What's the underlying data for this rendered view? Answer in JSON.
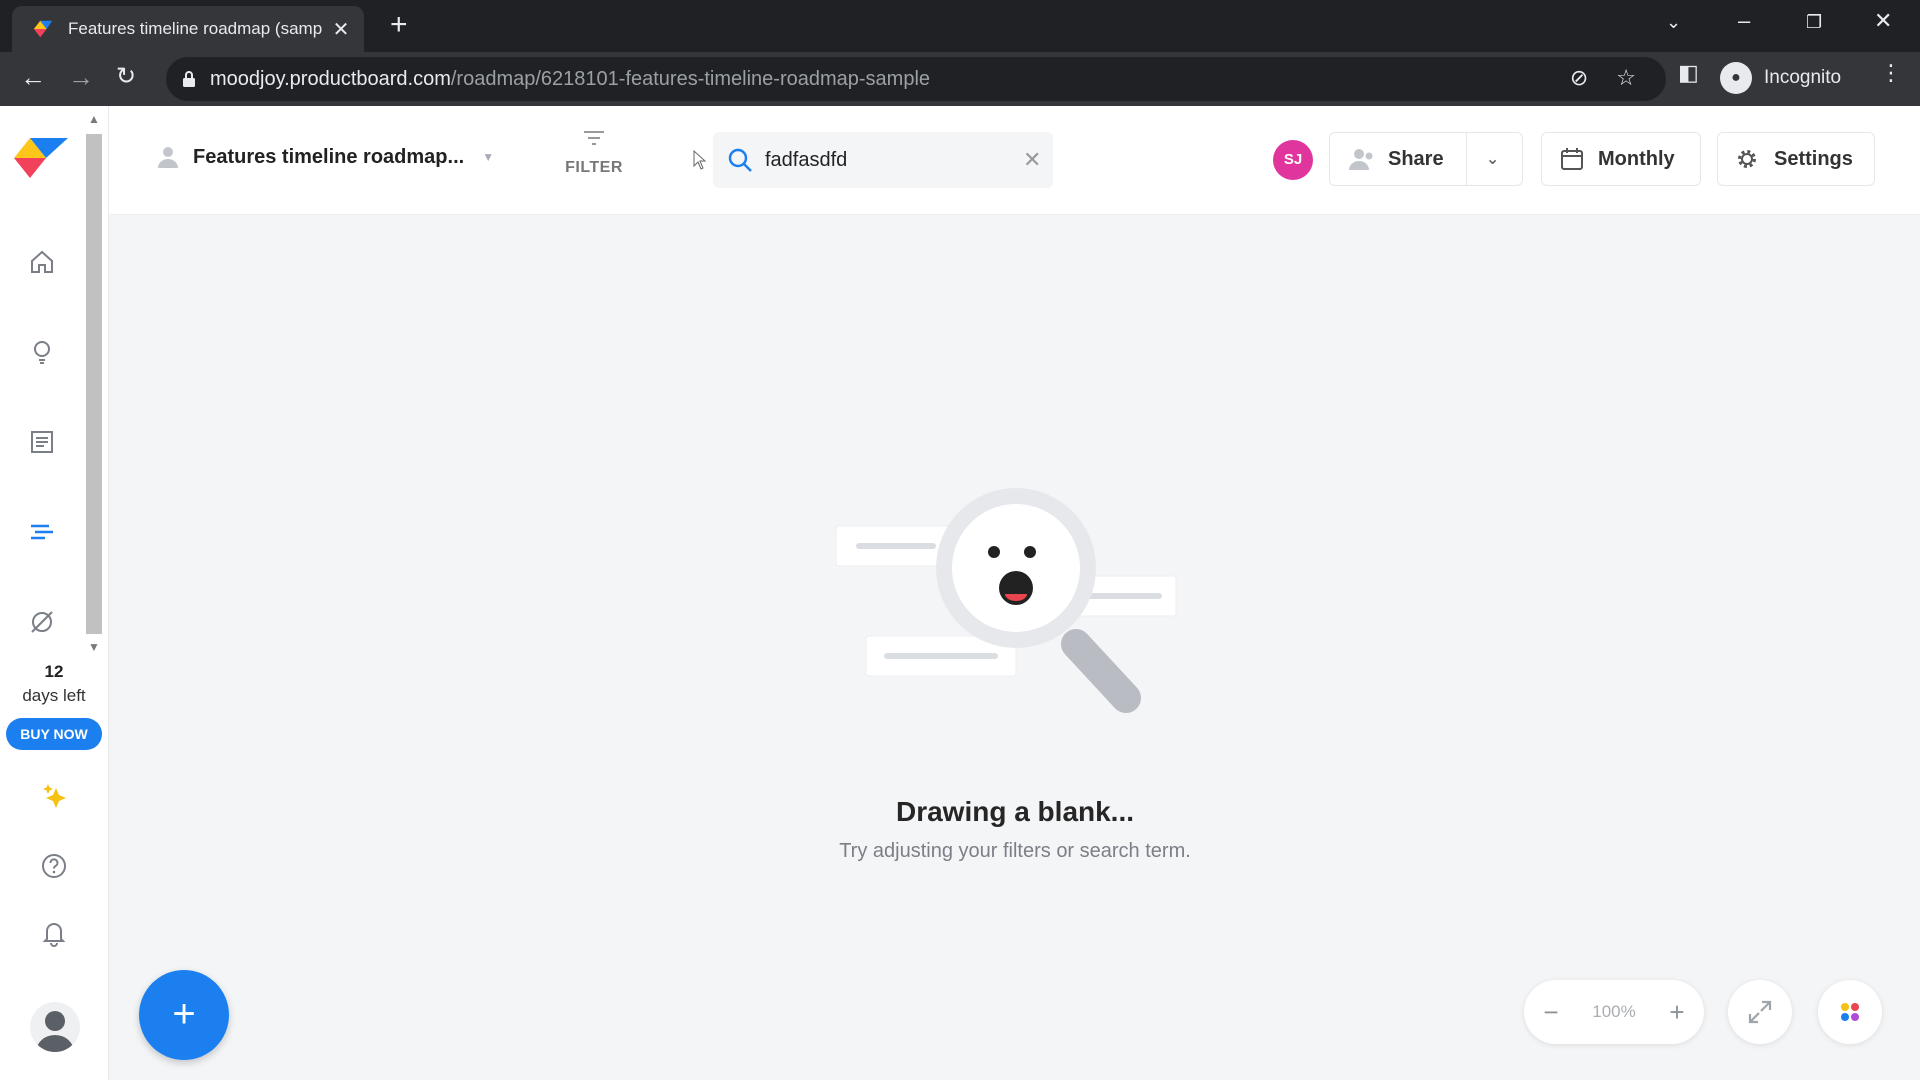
{
  "browser": {
    "tab_title": "Features timeline roadmap (samp",
    "url_host": "moodjoy.productboard.com",
    "url_path": "/roadmap/6218101-features-timeline-roadmap-sample",
    "incognito_label": "Incognito"
  },
  "sidebar": {
    "items": [
      {
        "name": "home-icon"
      },
      {
        "name": "insights-icon"
      },
      {
        "name": "features-icon"
      },
      {
        "name": "roadmap-icon"
      },
      {
        "name": "portal-icon"
      }
    ],
    "trial_days": "12",
    "trial_label": "days left",
    "buy_now": "BUY NOW"
  },
  "header": {
    "roadmap_title": "Features timeline roadmap...",
    "filter_label": "FILTER",
    "search_value": "fadfasdfd",
    "user_initials": "SJ",
    "share_label": "Share",
    "view_label": "Monthly",
    "settings_label": "Settings"
  },
  "empty_state": {
    "title": "Drawing a blank...",
    "subtitle": "Try adjusting your filters or search term."
  },
  "zoom": {
    "value": "100%"
  },
  "colors": {
    "accent": "#1b7ff0",
    "avatar": "#e0359c",
    "background": "#f4f5f7"
  }
}
